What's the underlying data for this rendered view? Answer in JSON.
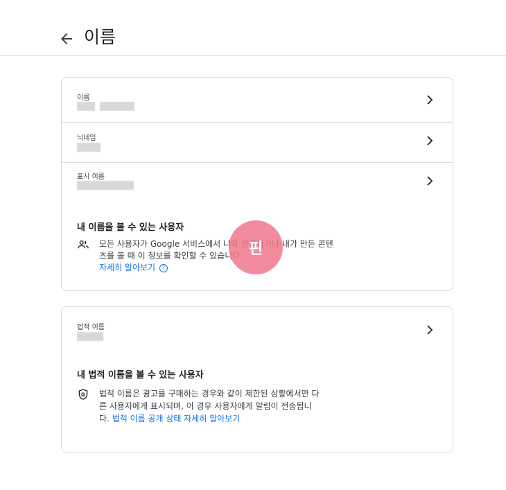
{
  "header": {
    "title": "이름"
  },
  "card1": {
    "rows": [
      {
        "label": "이름"
      },
      {
        "label": "닉네임"
      },
      {
        "label": "표시 이름"
      }
    ],
    "visibility": {
      "title": "내 이름을 볼 수 있는 사용자",
      "text": "모든 사용자가 Google 서비스에서 나와 연락하거나 내가 만든 콘텐츠를 볼 때 이 정보를 확인할 수 있습니다.",
      "link": "자세히 알아보기",
      "icon": "people-icon"
    }
  },
  "card2": {
    "rows": [
      {
        "label": "법적 이름"
      }
    ],
    "visibility": {
      "title": "내 법적 이름을 볼 수 있는 사용자",
      "text": "법적 이름은 광고를 구매하는 경우와 같이 제한된 상황에서만 다른 사용자에게 표시되며, 이 경우 사용자에게 알림이 전송됩니다.",
      "link": "법적 이름 공개 상태 자세히 알아보기",
      "icon": "shield-g-icon"
    }
  },
  "watermark": {
    "text": "핀"
  },
  "colors": {
    "accent": "#1a73e8",
    "divider": "#dadce0",
    "watermark": "#f0788c"
  }
}
